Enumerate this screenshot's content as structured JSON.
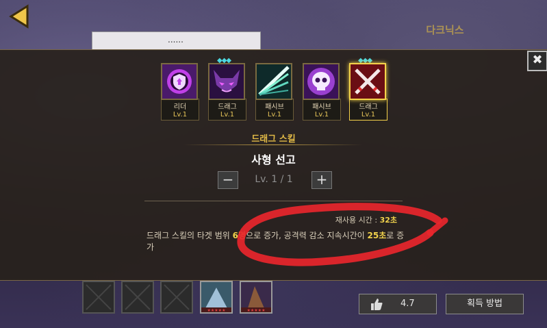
{
  "header": {
    "hero_name": "다크닉스",
    "search_text": "......"
  },
  "modal": {
    "close_label": "✖",
    "skills": [
      {
        "name": "리더",
        "level": "Lv.1",
        "icon": "leader-shield-icon",
        "gems": 0,
        "selected": false
      },
      {
        "name": "드래그",
        "level": "Lv.1",
        "icon": "demon-face-icon",
        "gems": 3,
        "selected": false
      },
      {
        "name": "패시브",
        "level": "Lv.1",
        "icon": "light-beams-icon",
        "gems": 0,
        "selected": false
      },
      {
        "name": "패시브",
        "level": "Lv.1",
        "icon": "skull-icon",
        "gems": 0,
        "selected": false
      },
      {
        "name": "드래그",
        "level": "Lv.1",
        "icon": "crossed-swords-icon",
        "gems": 3,
        "selected": true
      }
    ],
    "section_label": "드래그 스킬",
    "skill_title": "사형 선고",
    "minus_label": "−",
    "plus_label": "+",
    "level_text": "Lv. 1 / 1",
    "cooldown_label": "재사용 시간 : ",
    "cooldown_value": "32초",
    "description_prefix": "드래그 스킬의 타겟 범위 ",
    "description_hl1": "6명",
    "description_mid": "으로 증가, 공격력 감소 지속시간이 ",
    "description_hl2": "25초",
    "description_suffix": "로 증가"
  },
  "footer": {
    "like_value": "4.7",
    "acquire_label": "획득 방법"
  },
  "colors": {
    "accent_gold": "#e3bb47",
    "highlight_yellow": "#f1d24c",
    "annotation_red": "#e8262c"
  }
}
